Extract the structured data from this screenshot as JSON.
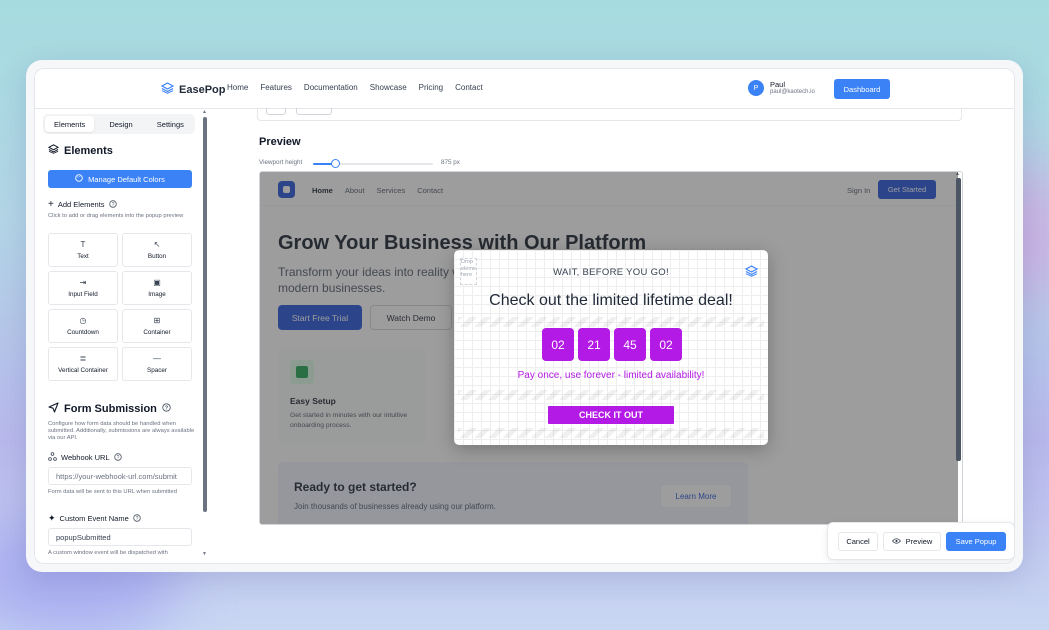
{
  "brand": {
    "name": "EasePop"
  },
  "nav": {
    "links": [
      "Home",
      "Features",
      "Documentation",
      "Showcase",
      "Pricing",
      "Contact"
    ]
  },
  "user": {
    "initial": "P",
    "name": "Paul",
    "email": "paul@kaotech.io"
  },
  "header": {
    "dashboard_label": "Dashboard"
  },
  "sidebar": {
    "tabs": [
      "Elements",
      "Design",
      "Settings"
    ],
    "active_tab": "Elements",
    "elements_title": "Elements",
    "manage_colors_label": "Manage Default Colors",
    "add_elements_title": "Add Elements",
    "add_elements_desc": "Click to add or drag elements into the popup preview",
    "elements": [
      {
        "label": "Text",
        "icon": "T"
      },
      {
        "label": "Button",
        "icon": "↖"
      },
      {
        "label": "Input Field",
        "icon": "⇥"
      },
      {
        "label": "Image",
        "icon": "▣"
      },
      {
        "label": "Countdown",
        "icon": "◷"
      },
      {
        "label": "Container",
        "icon": "⊞"
      },
      {
        "label": "Vertical Container",
        "icon": "≣"
      },
      {
        "label": "Spacer",
        "icon": "—"
      }
    ],
    "form_title": "Form Submission",
    "form_desc": "Configure how form data should be handled when submitted. Additionally, submissions are always available via our API.",
    "webhook_label": "Webhook URL",
    "webhook_placeholder": "https://your-webhook-url.com/submit",
    "webhook_help": "Form data will be sent to this URL when submitted",
    "event_label": "Custom Event Name",
    "event_value": "popupSubmitted",
    "event_help": "A custom window event will be dispatched with"
  },
  "main": {
    "preview_title": "Preview",
    "viewport_label": "Viewport height",
    "viewport_value": "875 px",
    "viewport_fraction": 0.18
  },
  "site": {
    "links": [
      "Home",
      "About",
      "Services",
      "Contact"
    ],
    "signin": "Sign In",
    "get_started": "Get Started",
    "hero_title": "Grow Your Business with Our Platform",
    "hero_sub": "Transform your ideas into reality with our powerful tools designed for modern businesses.",
    "start_trial": "Start Free Trial",
    "watch_demo": "Watch Demo",
    "feature_title": "Easy Setup",
    "feature_desc": "Get started in minutes with our intuitive onboarding process.",
    "cta_title": "Ready to get started?",
    "cta_desc": "Join thousands of businesses already using our platform.",
    "cta_button": "Learn More"
  },
  "popup": {
    "drop_hint": "Drop elements here",
    "subtitle": "WAIT, BEFORE YOU GO!",
    "title": "Check out the limited lifetime deal!",
    "countdown": [
      "02",
      "21",
      "45",
      "02"
    ],
    "tagline": "Pay once, use forever - limited availability!",
    "cta": "CHECK IT OUT",
    "accent": "#b31ae5"
  },
  "actions": {
    "cancel": "Cancel",
    "preview": "Preview",
    "save": "Save Popup"
  },
  "colors": {
    "primary": "#3b82f6",
    "site_primary": "#1d4ed8",
    "popup_accent": "#b31ae5"
  }
}
